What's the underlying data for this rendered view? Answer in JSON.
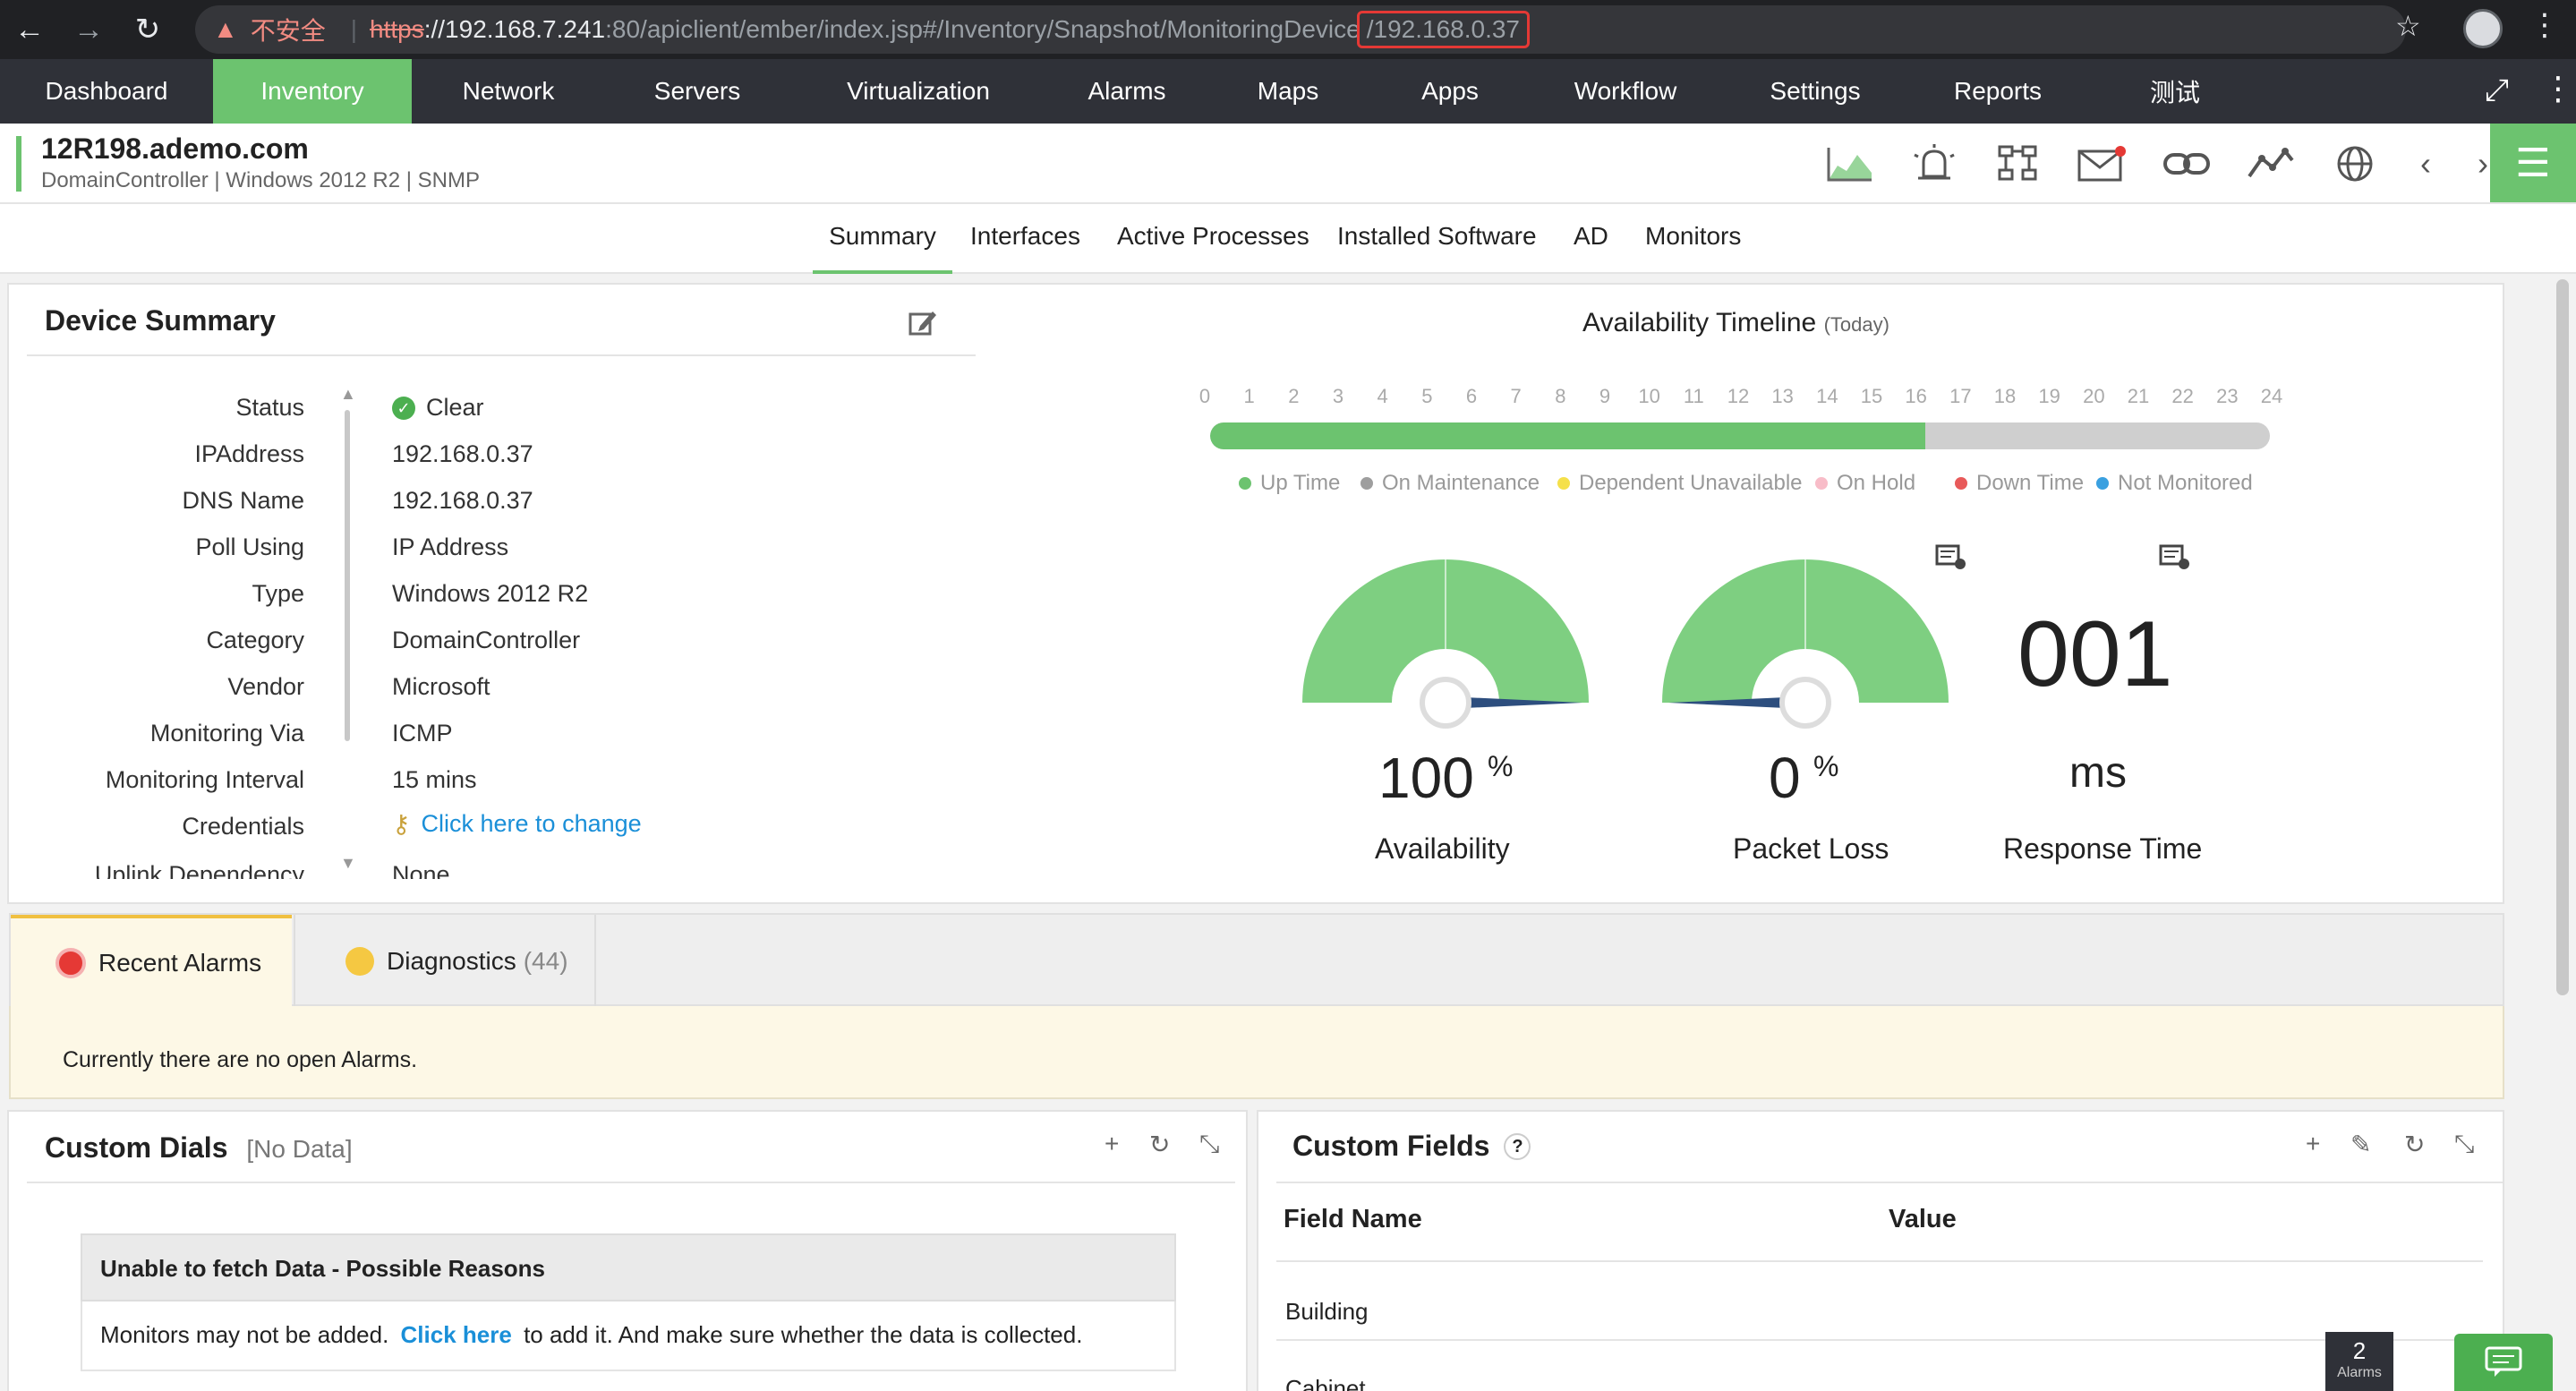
{
  "browser": {
    "insecure_label": "不安全",
    "url_scheme": "https",
    "url_host": "://192.168.7.241",
    "url_path": ":80/apiclient/ember/index.jsp#/Inventory/Snapshot/MonitoringDevice",
    "url_tail": "/192.168.0.37"
  },
  "nav": {
    "items": [
      "Dashboard",
      "Inventory",
      "Network",
      "Servers",
      "Virtualization",
      "Alarms",
      "Maps",
      "Apps",
      "Workflow",
      "Settings",
      "Reports",
      "测试"
    ],
    "active": "Inventory"
  },
  "device": {
    "name": "12R198.ademo.com",
    "subtitle": "DomainController | Windows 2012 R2  | SNMP"
  },
  "subtabs": [
    "Summary",
    "Interfaces",
    "Active Processes",
    "Installed Software",
    "AD",
    "Monitors"
  ],
  "summary": {
    "title": "Device Summary",
    "labels": [
      "Status",
      "IPAddress",
      "DNS Name",
      "Poll Using",
      "Type",
      "Category",
      "Vendor",
      "Monitoring Via",
      "Monitoring Interval",
      "Credentials",
      "Uplink Dependency"
    ],
    "values": [
      "Clear",
      "192.168.0.37",
      "192.168.0.37",
      "IP Address",
      "Windows 2012 R2",
      "DomainController",
      "Microsoft",
      "ICMP",
      "15 mins",
      "Click here to change",
      "None"
    ]
  },
  "timeline": {
    "title": "Availability Timeline",
    "title_suffix": "(Today)",
    "hours": [
      "0",
      "1",
      "2",
      "3",
      "4",
      "5",
      "6",
      "7",
      "8",
      "9",
      "10",
      "11",
      "12",
      "13",
      "14",
      "15",
      "16",
      "17",
      "18",
      "19",
      "20",
      "21",
      "22",
      "23",
      "24"
    ],
    "uptime_fraction": 0.675,
    "legend": [
      {
        "label": "Up Time",
        "color": "#6cc36f"
      },
      {
        "label": "On Maintenance",
        "color": "#9e9e9e"
      },
      {
        "label": "Dependent Unavailable",
        "color": "#f5e04a"
      },
      {
        "label": "On Hold",
        "color": "#f8bcc8"
      },
      {
        "label": "Down Time",
        "color": "#e85a5a"
      },
      {
        "label": "Not Monitored",
        "color": "#3aa0e0"
      }
    ]
  },
  "gauges": {
    "availability": {
      "value": "100",
      "unit": "%",
      "label": "Availability",
      "level": 1.0
    },
    "packet_loss": {
      "value": "0",
      "unit": "%",
      "label": "Packet Loss",
      "level": 0.0
    },
    "response_time": {
      "value": "001",
      "unit": "ms",
      "label": "Response Time"
    }
  },
  "alarms": {
    "tab_recent": "Recent Alarms",
    "tab_diag": "Diagnostics",
    "diag_count": "(44)",
    "message": "Currently there are no open Alarms."
  },
  "custom_dials": {
    "title": "Custom Dials",
    "tag": "[No Data]",
    "box_title": "Unable to fetch Data - Possible Reasons",
    "msg_prefix": "Monitors may not be added.",
    "msg_link": "Click here",
    "msg_suffix": "to add it. And make sure whether the data is collected."
  },
  "custom_fields": {
    "title": "Custom Fields",
    "help": "?",
    "col_name": "Field Name",
    "col_value": "Value",
    "rows": [
      "Building",
      "Cabinet"
    ]
  },
  "footer": {
    "alarm_count": "2",
    "alarm_label": "Alarms"
  },
  "colors": {
    "accent": "#6cc36f",
    "nav_bg": "#2f3138",
    "gauge_needle": "#2d4e7e"
  }
}
